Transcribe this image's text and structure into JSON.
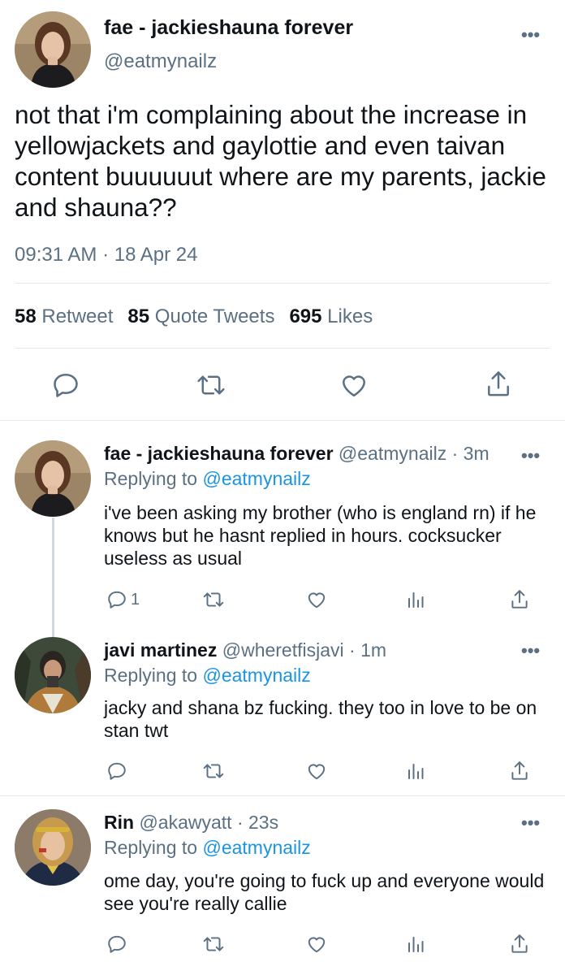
{
  "main_tweet": {
    "name": "fae - jackieshauna forever",
    "handle": "@eatmynailz",
    "text": "not that i'm complaining about the increase in yellowjackets and gaylottie and even taivan content buuuuuut where are my parents, jackie and shauna??",
    "timestamp": "09:31 AM · 18 Apr 24",
    "stats": {
      "retweets_count": "58",
      "retweets_label": "Retweet",
      "quotes_count": "85",
      "quotes_label": "Quote Tweets",
      "likes_count": "695",
      "likes_label": "Likes"
    },
    "more_label": "•••"
  },
  "replies": [
    {
      "name": "fae - jackieshauna forever",
      "handle": "@eatmynailz",
      "time": "· 3m",
      "replying_prefix": "Replying to",
      "replying_to": "@eatmynailz",
      "text": "i've been asking my brother (who is england rn) if he knows but he hasnt replied in hours. cocksucker useless as usual",
      "reply_count": "1"
    },
    {
      "name": "javi martinez",
      "handle": "@wheretfisjavi",
      "time": "· 1m",
      "replying_prefix": "Replying to",
      "replying_to": "@eatmynailz",
      "text": "jacky and shana bz fucking. they too in love to be on stan twt",
      "reply_count": ""
    },
    {
      "name": "Rin",
      "handle": "@akawyatt",
      "time": "· 23s",
      "replying_prefix": "Replying to",
      "replying_to": "@eatmynailz",
      "text": "ome day, you're going to fuck up and everyone would see you're really callie",
      "reply_count": ""
    }
  ],
  "icons": {
    "reply": "reply-icon",
    "retweet": "retweet-icon",
    "like": "heart-icon",
    "share": "share-icon",
    "analytics": "analytics-icon",
    "more": "more-icon"
  },
  "colors": {
    "accent": "#1b95e0",
    "secondary_text": "#5b7083",
    "primary_text": "#0f1419",
    "divider": "#e1e8ed"
  }
}
